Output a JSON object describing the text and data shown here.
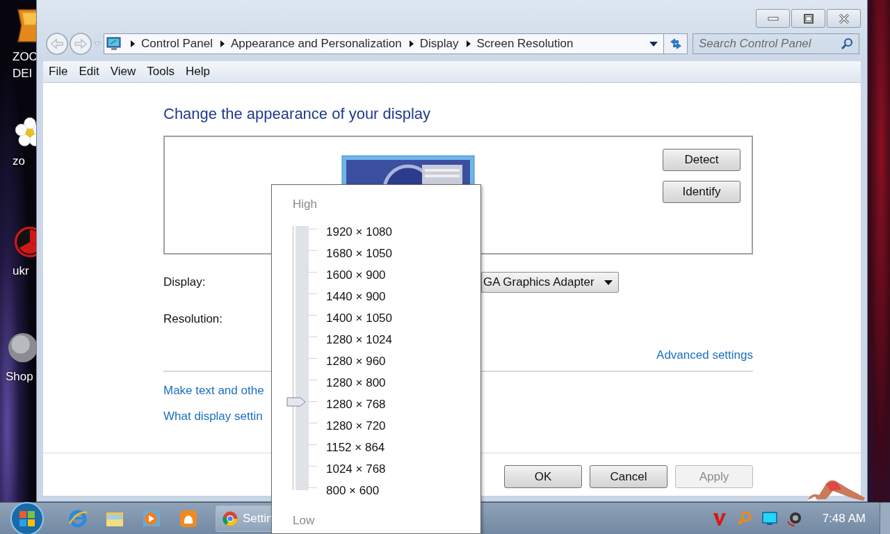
{
  "desktop": {
    "icons": [
      {
        "kind": "tile",
        "lines": [
          "ZOC",
          "DEI"
        ]
      },
      {
        "kind": "flower",
        "lines": [
          "zo"
        ]
      },
      {
        "kind": "hazard",
        "lines": [
          "ukr"
        ]
      },
      {
        "kind": "sphere",
        "lines": [
          "Shop"
        ]
      }
    ]
  },
  "address_bar": {
    "breadcrumb": [
      "Control Panel",
      "Appearance and Personalization",
      "Display",
      "Screen Resolution"
    ]
  },
  "search": {
    "placeholder": "Search Control Panel"
  },
  "menu": [
    "File",
    "Edit",
    "View",
    "Tools",
    "Help"
  ],
  "heading": "Change the appearance of your display",
  "preview": {
    "buttons": [
      "Detect",
      "Identify"
    ]
  },
  "display": {
    "label": "Display:",
    "value": "GA Graphics Adapter"
  },
  "resolution": {
    "label": "Resolution:"
  },
  "advanced_link": "Advanced settings",
  "links": [
    "Make text and othe",
    "What display settin"
  ],
  "buttons": [
    {
      "label": "OK",
      "disabled": false
    },
    {
      "label": "Cancel",
      "disabled": false
    },
    {
      "label": "Apply",
      "disabled": true
    }
  ],
  "resolution_menu": {
    "high": "High",
    "low": "Low",
    "level": 0.33,
    "options": [
      "1920 × 1080",
      "1680 × 1050",
      "1600 × 900",
      "1440 × 900",
      "1400 × 1050",
      "1280 × 1024",
      "1280 × 960",
      "1280 × 800",
      "1280 × 768",
      "1280 × 720",
      "1152 × 864",
      "1024 × 768",
      "800 × 600"
    ]
  },
  "taskbar": {
    "pinned": [
      {
        "kind": "browser"
      },
      {
        "kind": "folder"
      },
      {
        "kind": "player"
      },
      {
        "kind": "squirrel"
      }
    ],
    "task": "Settin",
    "tray": [
      {
        "kind": "v"
      },
      {
        "kind": "magnifier"
      },
      {
        "kind": "monitor"
      },
      {
        "kind": "speaker"
      }
    ],
    "clock": "7:48 AM"
  }
}
